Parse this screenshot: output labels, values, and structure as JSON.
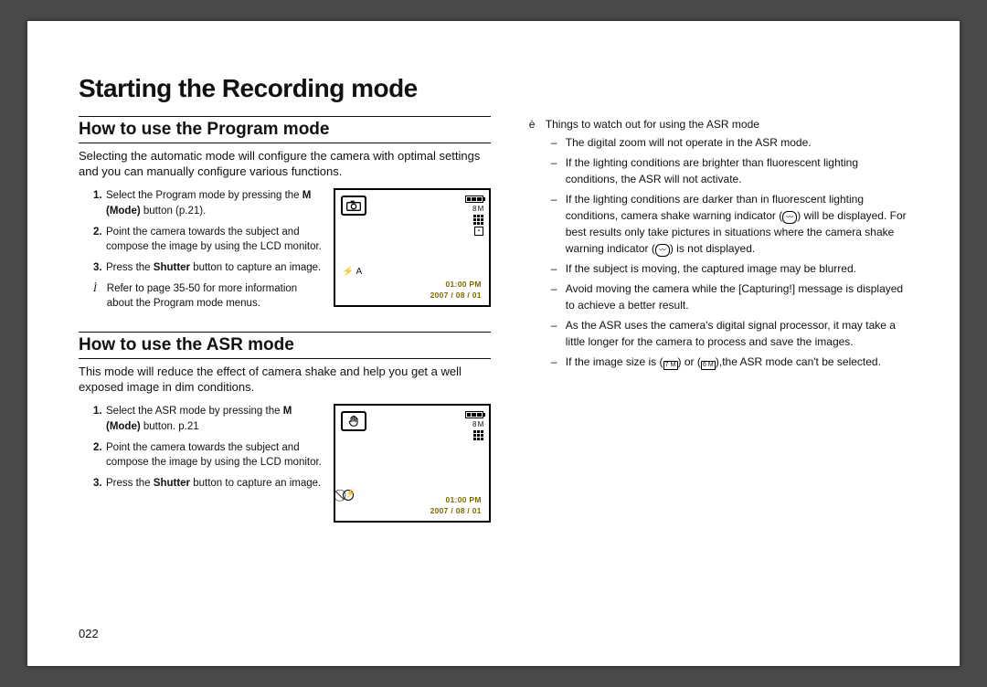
{
  "page_title": "Starting the Recording mode",
  "page_number": "022",
  "left": {
    "program": {
      "heading": "How to use the Program mode",
      "intro": "Selecting the automatic mode will configure the camera with optimal settings and you can manually configure various functions.",
      "steps": {
        "s1_n": "1.",
        "s1_a": "Select the Program mode by pressing the ",
        "s1_b": "M (Mode)",
        "s1_c": " button (p.21).",
        "s2_n": "2.",
        "s2": "Point the camera towards the subject and compose the image by using the LCD monitor.",
        "s3_n": "3.",
        "s3_a": "Press the ",
        "s3_b": "Shutter",
        "s3_c": " button to capture an image."
      },
      "note_bullet": "Ì",
      "note": "Refer to page 35-50 for more information about the Program mode menus.",
      "lcd": {
        "mode_icon": "program-mode-icon",
        "res": "8 M",
        "flash_label": "⚡ A",
        "time": "01:00 PM",
        "date": "2007 / 08 / 01"
      }
    },
    "asr": {
      "heading": "How to use the ASR mode",
      "intro": "This mode will reduce the effect of camera shake and help you get a well exposed image in dim conditions.",
      "steps": {
        "s1_n": "1.",
        "s1_a": "Select the ASR mode by pressing the ",
        "s1_b": "M (Mode)",
        "s1_c": " button. p.21",
        "s2_n": "2.",
        "s2": "Point the camera towards the subject and compose the image by using the LCD monitor.",
        "s3_n": "3.",
        "s3_a": "Press the ",
        "s3_b": "Shutter",
        "s3_c": " button to capture an image."
      },
      "lcd": {
        "mode_icon": "asr-mode-icon",
        "res": "8 M",
        "no_flash": "⦸",
        "time": "01:00 PM",
        "date": "2007 / 08 / 01"
      }
    }
  },
  "right": {
    "intro_bullet": "è",
    "intro": "Things to watch out for using the ASR mode",
    "items": {
      "i1": "The digital zoom will not operate in the ASR mode.",
      "i2": "If the lighting conditions are brighter than fluorescent lighting conditions, the ASR will not activate.",
      "i3_a": "If the lighting conditions are darker than in fluorescent lighting conditions, camera shake warning indicator (",
      "i3_b": ") will be displayed. For best results only take pictures in situations where the camera shake warning indicator (",
      "i3_c": ") is not displayed.",
      "i4": "If the subject is moving, the captured image may be blurred.",
      "i5": "Avoid moving the camera while the [Capturing!] message is displayed to achieve a better result.",
      "i6": "As the ASR uses the camera's digital signal processor, it may take a little longer for the camera to process and save the images.",
      "i7_a": "If the image size is (",
      "i7_b": ") or (",
      "i7_c": "),the ASR mode can't be selected.",
      "shake_glyph": "〰",
      "icon7_label": "7 M",
      "icon6_label": "6 M"
    }
  }
}
